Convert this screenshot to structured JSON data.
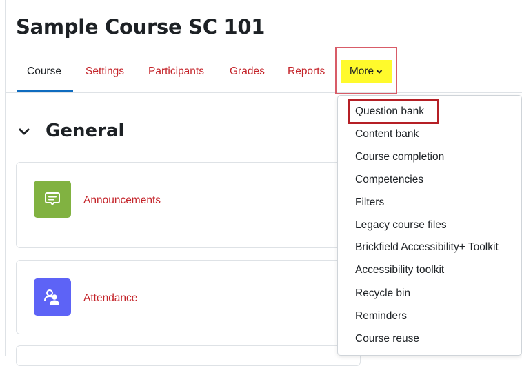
{
  "header": {
    "title": "Sample Course SC 101"
  },
  "nav": {
    "tabs": [
      {
        "label": "Course",
        "active": true
      },
      {
        "label": "Settings"
      },
      {
        "label": "Participants"
      },
      {
        "label": "Grades"
      },
      {
        "label": "Reports"
      }
    ],
    "more_label": "More"
  },
  "section": {
    "title": "General"
  },
  "activities": [
    {
      "label": "Announcements",
      "icon": "forum-icon",
      "color": "#81b241"
    },
    {
      "label": "Attendance",
      "icon": "attendance-icon",
      "color": "#5d63f6"
    }
  ],
  "more_menu": {
    "items": [
      "Question bank",
      "Content bank",
      "Course completion",
      "Competencies",
      "Filters",
      "Legacy course files",
      "Brickfield Accessibility+ Toolkit",
      "Accessibility toolkit",
      "Recycle bin",
      "Reminders",
      "Course reuse"
    ],
    "highlighted": "Question bank"
  },
  "colors": {
    "link": "#c4242a",
    "active_tab_underline": "#0f6cbf",
    "more_highlight": "#fffa2c",
    "annotation_box": "#b51f25"
  }
}
